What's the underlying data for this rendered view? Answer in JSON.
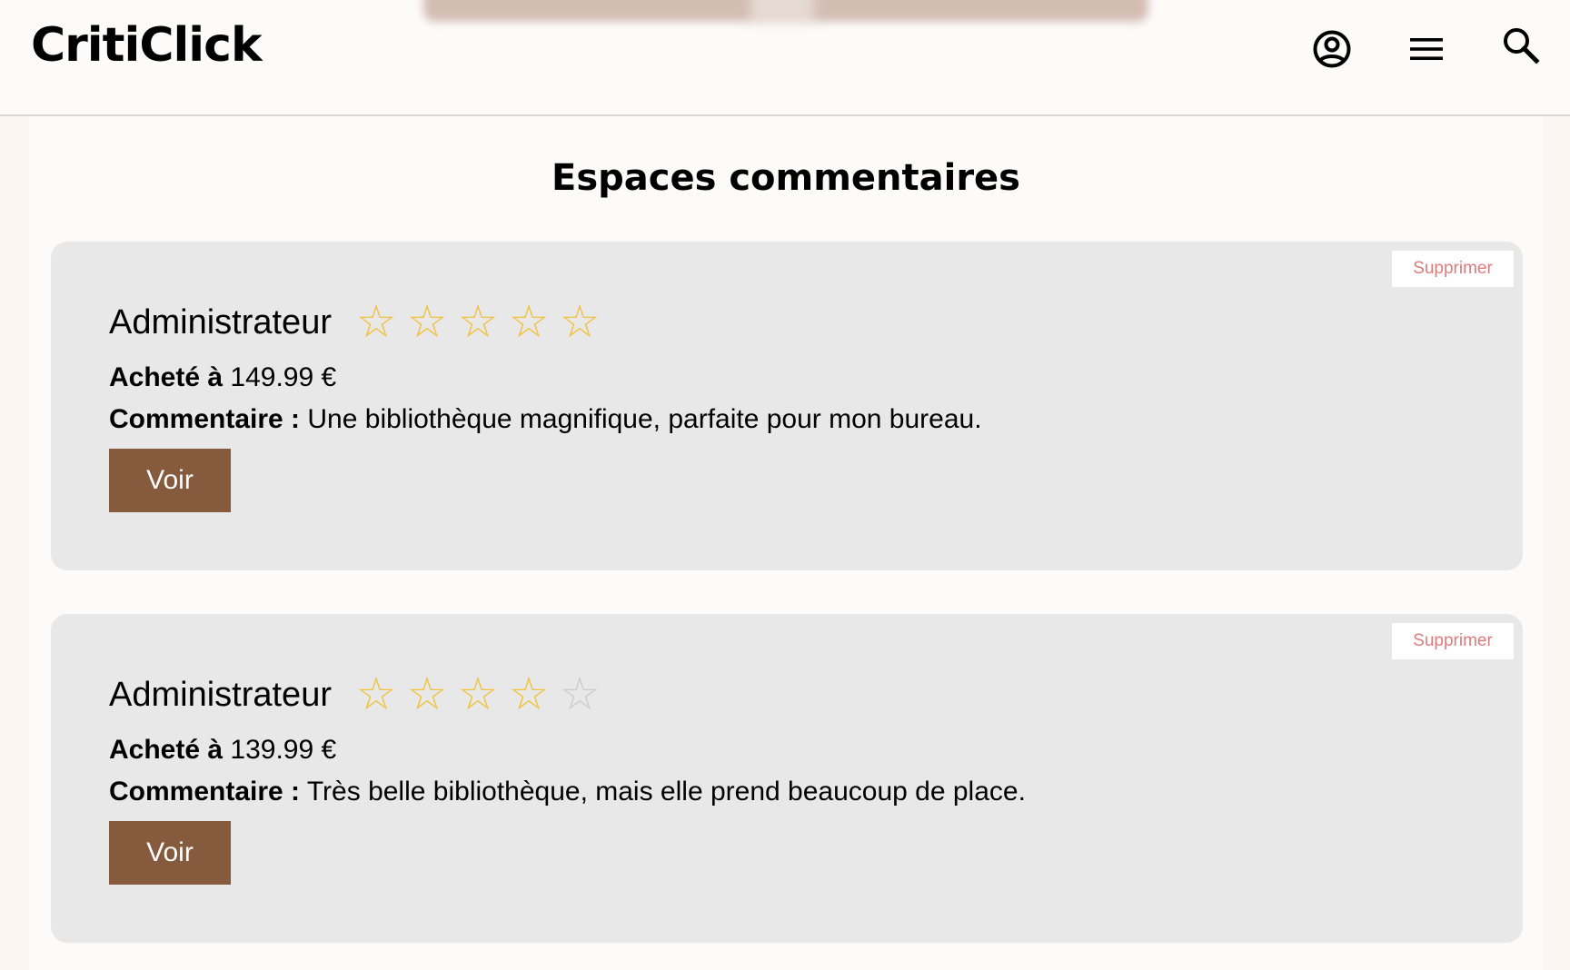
{
  "header": {
    "logo": "CritiClick",
    "icons": {
      "account": "account-circle-icon",
      "menu": "hamburger-menu-icon",
      "search": "search-icon"
    }
  },
  "page": {
    "title": "Espaces commentaires"
  },
  "colors": {
    "accent_brown": "#855a3d",
    "star_filled": "#f0c23e",
    "star_empty": "#cdcdcd",
    "delete_text": "#de7c7c",
    "card_bg": "#e8e8e9"
  },
  "reviews": [
    {
      "author": "Administrateur",
      "rating": 5,
      "max_rating": 5,
      "price_label": "Acheté à",
      "price_value": "149.99 €",
      "comment_label": "Commentaire :",
      "comment_text": "Une bibliothèque magnifique, parfaite pour mon bureau.",
      "delete_label": "Supprimer",
      "view_label": "Voir"
    },
    {
      "author": "Administrateur",
      "rating": 4,
      "max_rating": 5,
      "price_label": "Acheté à",
      "price_value": "139.99 €",
      "comment_label": "Commentaire :",
      "comment_text": "Très belle bibliothèque, mais elle prend beaucoup de place.",
      "delete_label": "Supprimer",
      "view_label": "Voir"
    }
  ]
}
